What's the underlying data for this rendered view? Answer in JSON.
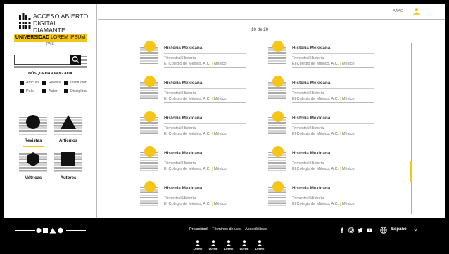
{
  "brand": {
    "line1": "ACCESO ABIERTO",
    "line2": "DIGITAL DIAMANTE",
    "university_bold": "UNIVERSIDAD",
    "university_light": "LOREM IPSUM",
    "country": "PAÍS"
  },
  "search": {
    "placeholder": "",
    "advanced_label": "BÚSQUEDA AVANZADA",
    "filters": [
      "Artículo",
      "Revista",
      "Institución",
      "País",
      "Autor",
      "Disciplina"
    ]
  },
  "categories": [
    {
      "label": "Revistas",
      "icon": "circle-icon",
      "active": true
    },
    {
      "label": "Artículos",
      "icon": "triangle-icon",
      "active": false
    },
    {
      "label": "Métricas",
      "icon": "hexagon-icon",
      "active": false
    },
    {
      "label": "Autores",
      "icon": "square-icon",
      "active": false
    }
  ],
  "topbar": {
    "label": "AAAO",
    "icon": "user-icon"
  },
  "pager": "10 de 20",
  "results": [
    {
      "title": "Historia Mexicana",
      "freq": "Trimestral",
      "disc": "Historia",
      "inst": "El Colegio de México, A.C.",
      "country": "México"
    },
    {
      "title": "Historia Mexicana",
      "freq": "Trimestral",
      "disc": "Historia",
      "inst": "El Colegio de México, A.C.",
      "country": "México"
    },
    {
      "title": "Historia Mexicana",
      "freq": "Trimestral",
      "disc": "Historia",
      "inst": "El Colegio de México, A.C.",
      "country": "México"
    },
    {
      "title": "Historia Mexicana",
      "freq": "Trimestral",
      "disc": "Historia",
      "inst": "El Colegio de México, A.C.",
      "country": "México"
    },
    {
      "title": "Historia Mexicana",
      "freq": "Trimestral",
      "disc": "Historia",
      "inst": "El Colegio de México, A.C.",
      "country": "México"
    },
    {
      "title": "Historia Mexicana",
      "freq": "Trimestral",
      "disc": "Historia",
      "inst": "El Colegio de México, A.C.",
      "country": "México"
    },
    {
      "title": "Historia Mexicana",
      "freq": "Trimestral",
      "disc": "Historia",
      "inst": "El Colegio de México, A.C.",
      "country": "México"
    },
    {
      "title": "Historia Mexicana",
      "freq": "Trimestral",
      "disc": "Historia",
      "inst": "El Colegio de México, A.C.",
      "country": "México"
    },
    {
      "title": "Historia Mexicana",
      "freq": "Trimestral",
      "disc": "Historia",
      "inst": "El Colegio de México, A.C.",
      "country": "México"
    },
    {
      "title": "Historia Mexicana",
      "freq": "Trimestral",
      "disc": "Historia",
      "inst": "El Colegio de México, A.C.",
      "country": "México"
    }
  ],
  "separator": "|",
  "footer": {
    "links": [
      "Privacidad",
      "Términos de uso",
      "Accesibilidad"
    ],
    "social": [
      "facebook-icon",
      "instagram-icon",
      "twitter-icon",
      "youtube-icon"
    ],
    "language": "Español",
    "people": [
      "Lorem",
      "Lorem",
      "Lorem",
      "Lorem",
      "Lorem"
    ]
  },
  "colors": {
    "accent": "#f5c518",
    "dark": "#111111",
    "footer_bg": "#000000"
  }
}
